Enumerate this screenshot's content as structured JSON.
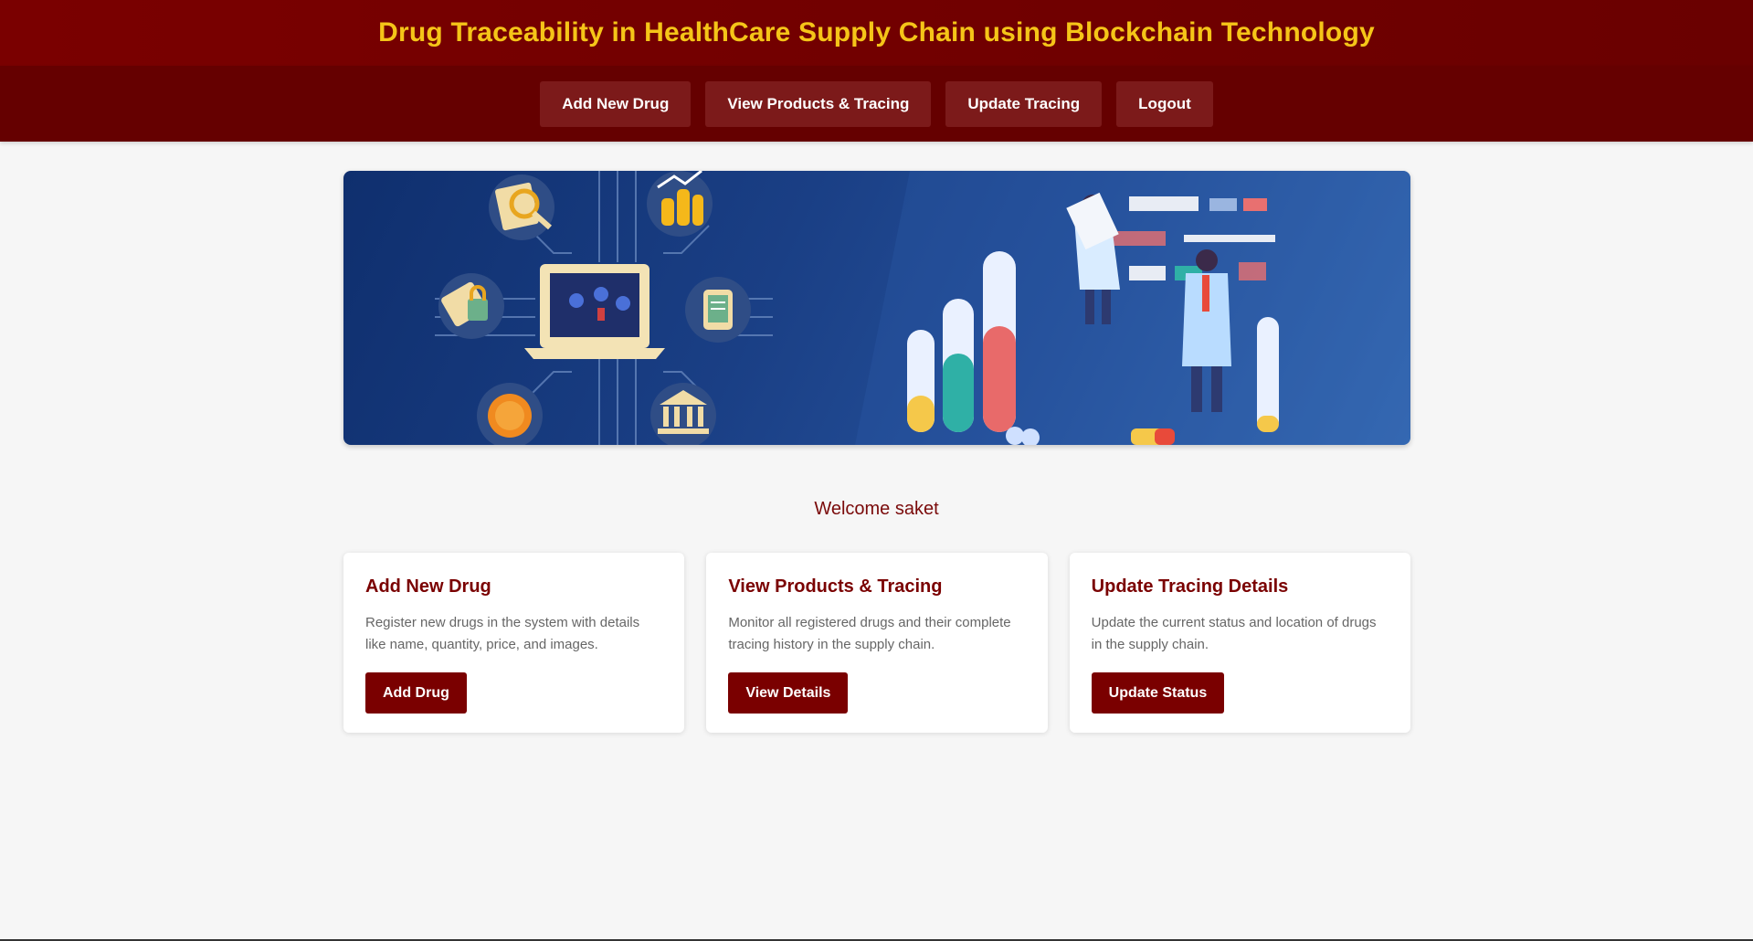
{
  "header": {
    "title": "Drug Traceability in HealthCare Supply Chain using Blockchain Technology"
  },
  "nav": {
    "items": [
      {
        "label": "Add New Drug"
      },
      {
        "label": "View Products & Tracing"
      },
      {
        "label": "Update Tracing"
      },
      {
        "label": "Logout"
      }
    ]
  },
  "welcome": {
    "text": "Welcome saket"
  },
  "cards": [
    {
      "title": "Add New Drug",
      "description": "Register new drugs in the system with details like name, quantity, price, and images.",
      "button": "Add Drug"
    },
    {
      "title": "View Products & Tracing",
      "description": "Monitor all registered drugs and their complete tracing history in the supply chain.",
      "button": "View Details"
    },
    {
      "title": "Update Tracing Details",
      "description": "Update the current status and location of drugs in the supply chain.",
      "button": "Update Status"
    }
  ],
  "colors": {
    "header_bg": "#7a0000",
    "nav_bg": "#650000",
    "title_text": "#f5c518",
    "accent": "#7a0000",
    "banner_bg": "#1a3f85"
  }
}
